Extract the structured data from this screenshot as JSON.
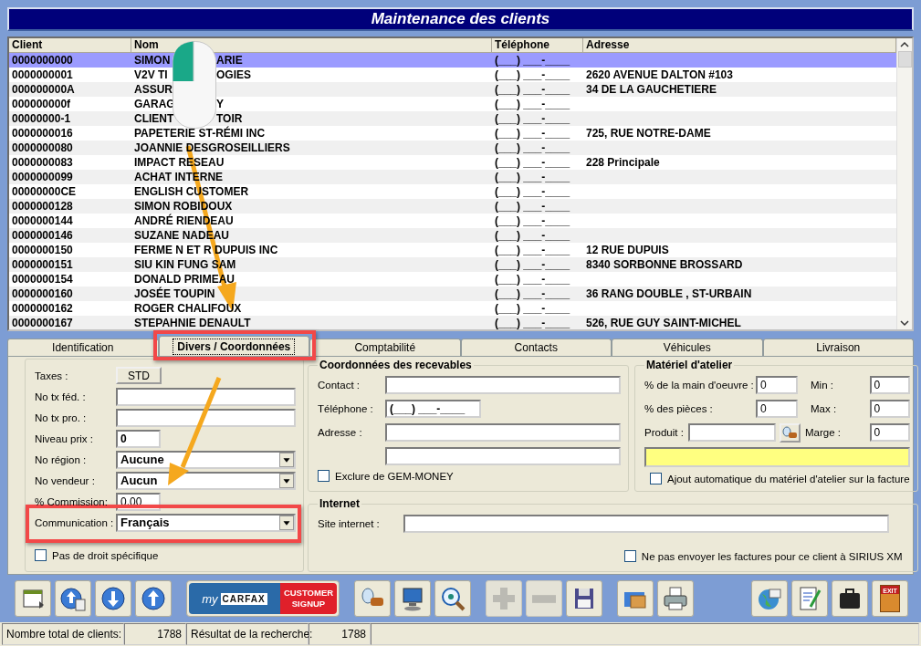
{
  "window": {
    "title": "Maintenance des clients"
  },
  "table": {
    "columns": [
      "Client",
      "Nom",
      "Téléphone",
      "Adresse"
    ],
    "rows": [
      {
        "client": "0000000000",
        "name": [
          "SIMON",
          "ARIE"
        ],
        "phone": "(___) ___-____",
        "selected": true
      },
      {
        "client": "0000000001",
        "name": [
          "V2V TI",
          "OGIES"
        ],
        "phone": "(___) ___-____",
        "address": "2620 AVENUE DALTON #103",
        "selected": false
      },
      {
        "client": "000000000A",
        "name": [
          "ASSUR"
        ],
        "phone": "(___) ___-____",
        "address": "34 DE LA GAUCHETIERE",
        "selected": false
      },
      {
        "client": "000000000f",
        "name": [
          "GARAG",
          "Y"
        ],
        "phone": "(___) ___-____",
        "selected": false
      },
      {
        "client": "00000000-1",
        "name": [
          "CLIENT",
          "TOIR"
        ],
        "phone": "(___) ___-____",
        "selected": false
      },
      {
        "client": "0000000016",
        "name": [
          "PAPETERIE ST-RÉMI INC"
        ],
        "phone": "(___) ___-____",
        "address": "725, RUE NOTRE-DAME",
        "selected": false
      },
      {
        "client": "0000000080",
        "name": [
          "JOANNIE DESGROSEILLIERS"
        ],
        "phone": "(___) ___-____",
        "selected": false
      },
      {
        "client": "0000000083",
        "name": [
          "IMPACT RESEAU"
        ],
        "phone": "(___) ___-____",
        "address": "228 Principale",
        "selected": false
      },
      {
        "client": "0000000099",
        "name": [
          "ACHAT INTERNE"
        ],
        "phone": "(___) ___-____",
        "selected": false
      },
      {
        "client": "00000000CE",
        "name": [
          "ENGLISH CUSTOMER"
        ],
        "phone": "(___) ___-____",
        "selected": false
      },
      {
        "client": "0000000128",
        "name": [
          "SIMON ROBIDOUX"
        ],
        "phone": "(___) ___-____",
        "selected": false
      },
      {
        "client": "0000000144",
        "name": [
          "ANDRÉ RIENDEAU"
        ],
        "phone": "(___) ___-____",
        "selected": false
      },
      {
        "client": "0000000146",
        "name": [
          "SUZANE NADEAU"
        ],
        "phone": "(___) ___-____",
        "selected": false
      },
      {
        "client": "0000000150",
        "name": [
          "FERME N ET R DUPUIS INC"
        ],
        "phone": "(___) ___-____",
        "address": "12 RUE DUPUIS",
        "selected": false
      },
      {
        "client": "0000000151",
        "name": [
          "SIU KIN FUNG SAM"
        ],
        "phone": "(___) ___-____",
        "address": "8340 SORBONNE BROSSARD",
        "selected": false
      },
      {
        "client": "0000000154",
        "name": [
          "DONALD PRIMEAU"
        ],
        "phone": "(___) ___-____",
        "selected": false
      },
      {
        "client": "0000000160",
        "name": [
          "JOSÉE TOUPIN"
        ],
        "phone": "(___) ___-____",
        "address": "36 RANG DOUBLE , ST-URBAIN",
        "selected": false
      },
      {
        "client": "0000000162",
        "name": [
          "ROGER CHALIFOUX"
        ],
        "phone": "(___) ___-____",
        "selected": false
      },
      {
        "client": "0000000167",
        "name": [
          "STEPAHNIE DENAULT"
        ],
        "phone": "(___) ___-____",
        "address": "526, RUE GUY SAINT-MICHEL",
        "selected": false
      }
    ]
  },
  "tabs": [
    {
      "label": "Identification",
      "selected": false
    },
    {
      "label": "Divers / Coordonnées",
      "selected": true
    },
    {
      "label": "Comptabilité",
      "selected": false
    },
    {
      "label": "Contacts",
      "selected": false
    },
    {
      "label": "Véhicules",
      "selected": false
    },
    {
      "label": "Livraison",
      "selected": false
    }
  ],
  "divers": {
    "fields": [
      {
        "kind": "button",
        "label": "Taxes :",
        "value": "STD"
      },
      {
        "kind": "text",
        "label": "No tx féd. :"
      },
      {
        "kind": "text",
        "label": "No tx pro. :"
      },
      {
        "kind": "short",
        "label": "Niveau prix :",
        "value": "0",
        "bold": true
      },
      {
        "kind": "select",
        "label": "No région :",
        "value": "Aucune"
      },
      {
        "kind": "select",
        "label": "No vendeur :",
        "value": "Aucun"
      },
      {
        "kind": "short",
        "label": "% Commission:",
        "value": "0.00",
        "bold": false
      },
      {
        "kind": "select",
        "label": "Communication :",
        "value": "Français"
      }
    ],
    "checkbox": {
      "label": "Pas de droit spécifique",
      "checked": false
    }
  },
  "recevables": {
    "title": "Coordonnées des recevables",
    "fields": [
      {
        "kind": "text",
        "label": "Contact :"
      },
      {
        "kind": "phone",
        "label": "Téléphone :",
        "value": "(___) ___-____"
      },
      {
        "kind": "text",
        "label": "Adresse :"
      },
      {
        "kind": "text"
      }
    ],
    "checkbox": {
      "label": "Exclure de GEM-MONEY",
      "checked": false
    }
  },
  "materiel": {
    "title": "Matériel d'atelier",
    "labour": {
      "label": "% de la main d'oeuvre :",
      "value": "0"
    },
    "min": {
      "label": "Min :",
      "value": "0"
    },
    "parts": {
      "label": "% des pièces :",
      "value": "0"
    },
    "max": {
      "label": "Max :",
      "value": "0"
    },
    "product": {
      "label": "Produit :"
    },
    "margin": {
      "label": "Marge :",
      "value": "0"
    },
    "checkbox": {
      "label": "Ajout automatique du matériel d'atelier sur la facture",
      "checked": false
    }
  },
  "internet": {
    "title": "Internet",
    "site_label": "Site internet :",
    "checkbox": {
      "label": "Ne pas envoyer les factures pour ce client à SIRIUS XM",
      "checked": false
    }
  },
  "toolbar": {
    "groups": [
      [
        {
          "kind": "window",
          "disabled": false
        },
        {
          "kind": "upload",
          "disabled": false
        },
        {
          "kind": "down",
          "disabled": false
        },
        {
          "kind": "up",
          "disabled": false
        }
      ],
      [
        {
          "kind": "carfax",
          "disabled": false,
          "texts": [
            "my",
            "CARFAX",
            "CUSTOMER",
            "SIGNUP"
          ]
        }
      ],
      [
        {
          "kind": "flashlight",
          "disabled": false
        },
        {
          "kind": "computer",
          "disabled": false
        },
        {
          "kind": "eye",
          "disabled": false
        }
      ],
      [
        {
          "kind": "plus",
          "disabled": true
        },
        {
          "kind": "minus",
          "disabled": true
        },
        {
          "kind": "floppy",
          "disabled": false
        }
      ],
      [
        {
          "kind": "box",
          "disabled": false
        },
        {
          "kind": "printer",
          "disabled": false
        }
      ],
      [
        {
          "kind": "globe",
          "disabled": false
        },
        {
          "kind": "document",
          "disabled": false
        },
        {
          "kind": "briefcase",
          "disabled": false
        },
        {
          "kind": "exit",
          "disabled": false,
          "label": "EXIT"
        }
      ]
    ]
  },
  "status_bar": [
    {
      "label": "Nombre total de clients:",
      "value": "1788"
    },
    {
      "label": "Résultat de la recherche:",
      "value": "1788"
    }
  ]
}
